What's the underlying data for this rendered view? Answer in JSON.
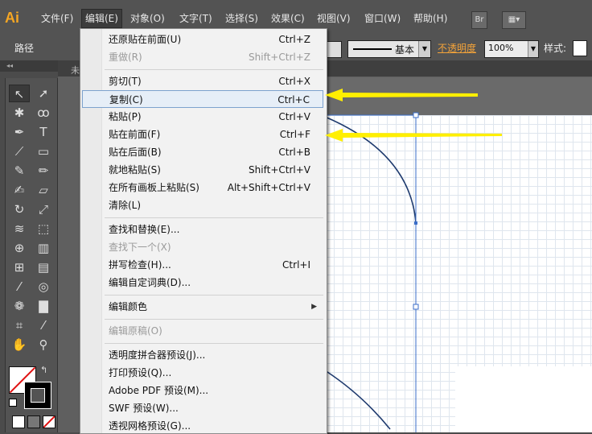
{
  "app": {
    "logo": "Ai"
  },
  "menubar": {
    "items": [
      "文件(F)",
      "编辑(E)",
      "对象(O)",
      "文字(T)",
      "选择(S)",
      "效果(C)",
      "视图(V)",
      "窗口(W)",
      "帮助(H)"
    ],
    "active_index": 1,
    "bridge_label": "Br"
  },
  "controlbar": {
    "selection_label": "路径",
    "stroke_style": "基本",
    "opacity_label": "不透明度",
    "opacity_value": "100%",
    "style_label": "样式:"
  },
  "document": {
    "tab_label": "未"
  },
  "edit_menu": {
    "items": [
      {
        "label": "还原贴在前面(U)",
        "shortcut": "Ctrl+Z",
        "enabled": true
      },
      {
        "label": "重做(R)",
        "shortcut": "Shift+Ctrl+Z",
        "enabled": false
      },
      {
        "label": "剪切(T)",
        "shortcut": "Ctrl+X",
        "enabled": true
      },
      {
        "label": "复制(C)",
        "shortcut": "Ctrl+C",
        "enabled": true,
        "highlighted": true
      },
      {
        "label": "粘贴(P)",
        "shortcut": "Ctrl+V",
        "enabled": true
      },
      {
        "label": "贴在前面(F)",
        "shortcut": "Ctrl+F",
        "enabled": true
      },
      {
        "label": "贴在后面(B)",
        "shortcut": "Ctrl+B",
        "enabled": true
      },
      {
        "label": "就地粘贴(S)",
        "shortcut": "Shift+Ctrl+V",
        "enabled": true
      },
      {
        "label": "在所有画板上粘贴(S)",
        "shortcut": "Alt+Shift+Ctrl+V",
        "enabled": true
      },
      {
        "label": "清除(L)",
        "shortcut": "",
        "enabled": true
      },
      {
        "label": "查找和替换(E)...",
        "shortcut": "",
        "enabled": true
      },
      {
        "label": "查找下一个(X)",
        "shortcut": "",
        "enabled": false
      },
      {
        "label": "拼写检查(H)...",
        "shortcut": "Ctrl+I",
        "enabled": true
      },
      {
        "label": "编辑自定词典(D)...",
        "shortcut": "",
        "enabled": true
      },
      {
        "label": "编辑颜色",
        "shortcut": "",
        "enabled": true,
        "submenu": true
      },
      {
        "label": "编辑原稿(O)",
        "shortcut": "",
        "enabled": false
      },
      {
        "label": "透明度拼合器预设(J)...",
        "shortcut": "",
        "enabled": true
      },
      {
        "label": "打印预设(Q)...",
        "shortcut": "",
        "enabled": true
      },
      {
        "label": "Adobe PDF 预设(M)...",
        "shortcut": "",
        "enabled": true
      },
      {
        "label": "SWF 预设(W)...",
        "shortcut": "",
        "enabled": true
      },
      {
        "label": "透视网格预设(G)...",
        "shortcut": "",
        "enabled": true
      }
    ]
  },
  "colors": {
    "accent_orange": "#f5a623",
    "annotation_yellow": "#ffef00",
    "menu_highlight": "#e6eef7",
    "panel_bg": "#535353"
  },
  "icons": {
    "tools": [
      "selection-icon",
      "direct-selection-icon",
      "magic-wand-icon",
      "lasso-icon",
      "pen-icon",
      "type-icon",
      "line-icon",
      "rectangle-icon",
      "paintbrush-icon",
      "pencil-icon",
      "blob-brush-icon",
      "eraser-icon",
      "rotate-icon",
      "scale-icon",
      "width-icon",
      "free-transform-icon",
      "shape-builder-icon",
      "perspective-grid-icon",
      "mesh-icon",
      "gradient-icon",
      "eyedropper-icon",
      "blend-icon",
      "symbol-sprayer-icon",
      "column-graph-icon",
      "artboard-icon",
      "slice-icon",
      "hand-icon",
      "zoom-icon"
    ]
  }
}
